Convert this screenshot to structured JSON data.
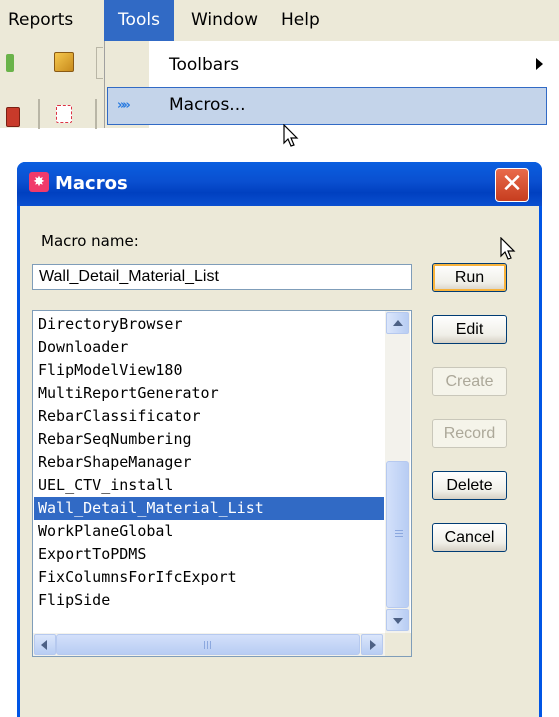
{
  "menubar": {
    "items": [
      "Reports",
      "Tools",
      "Window",
      "Help"
    ],
    "active": "Tools"
  },
  "tools_menu": {
    "items": [
      {
        "label": "Toolbars",
        "submenu": true
      },
      {
        "label": "Macros...",
        "icon": "macro-chevrons-icon",
        "highlighted": true
      }
    ]
  },
  "dialog": {
    "title": "Macros",
    "close_label": "✕",
    "macro_name_label": "Macro name:",
    "macro_name_value": "Wall_Detail_Material_List",
    "macros": [
      "DirectoryBrowser",
      "Downloader",
      "FlipModelView180",
      "MultiReportGenerator",
      "RebarClassificator",
      "RebarSeqNumbering",
      "RebarShapeManager",
      "UEL_CTV_install",
      "Wall_Detail_Material_List",
      "WorkPlaneGlobal",
      "ExportToPDMS",
      "FixColumnsForIfcExport",
      "FlipSide"
    ],
    "selected_index": 8,
    "buttons": {
      "run": "Run",
      "edit": "Edit",
      "create": "Create",
      "record": "Record",
      "delete": "Delete",
      "cancel": "Cancel"
    },
    "disabled_buttons": [
      "create",
      "record"
    ]
  },
  "colors": {
    "xp_blue_title": "#0055e5",
    "selection": "#316ac5",
    "dialog_face": "#ece9d8",
    "menu_highlight": "#c4d4ea",
    "close_red": "#c63d1f"
  }
}
